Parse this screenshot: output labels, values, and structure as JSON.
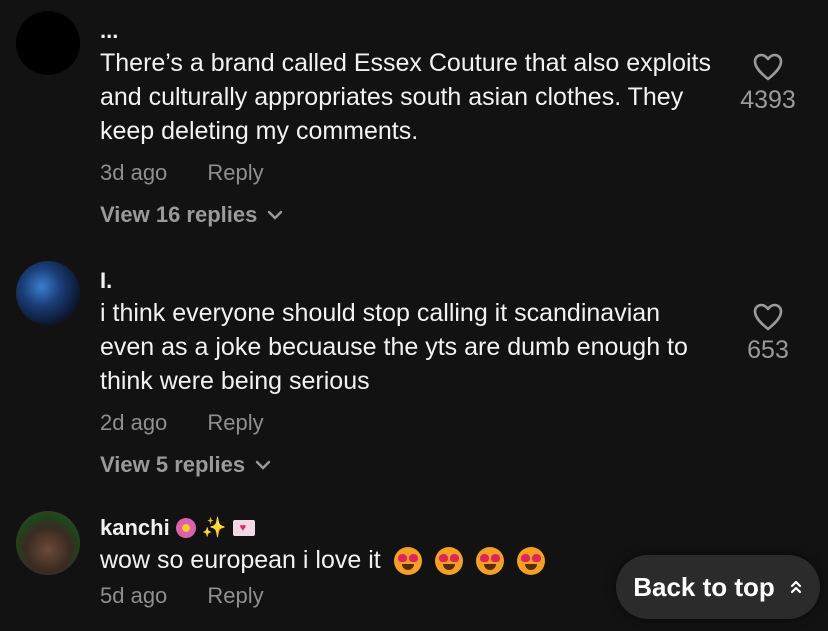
{
  "comments": [
    {
      "username": "...",
      "text": "There’s a brand called Essex Couture that also exploits and culturally appropriates south asian clothes. They keep deleting my comments.",
      "time": "3d ago",
      "reply_label": "Reply",
      "view_replies": "View 16 replies",
      "likes": "4393"
    },
    {
      "username": "I.",
      "text": "i think everyone should stop calling it scandinavian even as a joke becuause the yts are dumb enough to think were being serious",
      "time": "2d ago",
      "reply_label": "Reply",
      "view_replies": "View 5 replies",
      "likes": "653"
    },
    {
      "username": "kanchi",
      "text": "wow so european i love it",
      "time": "5d ago",
      "reply_label": "Reply"
    }
  ],
  "back_to_top": "Back to top",
  "icons": [
    "heart-outline-icon",
    "chevron-down-icon",
    "double-chevron-up-icon",
    "heart-eyes-emoji"
  ],
  "colors": {
    "background": "#121212",
    "text": "#f2f2f2",
    "muted": "#8f8f8f",
    "button": "#2b2b2b"
  }
}
